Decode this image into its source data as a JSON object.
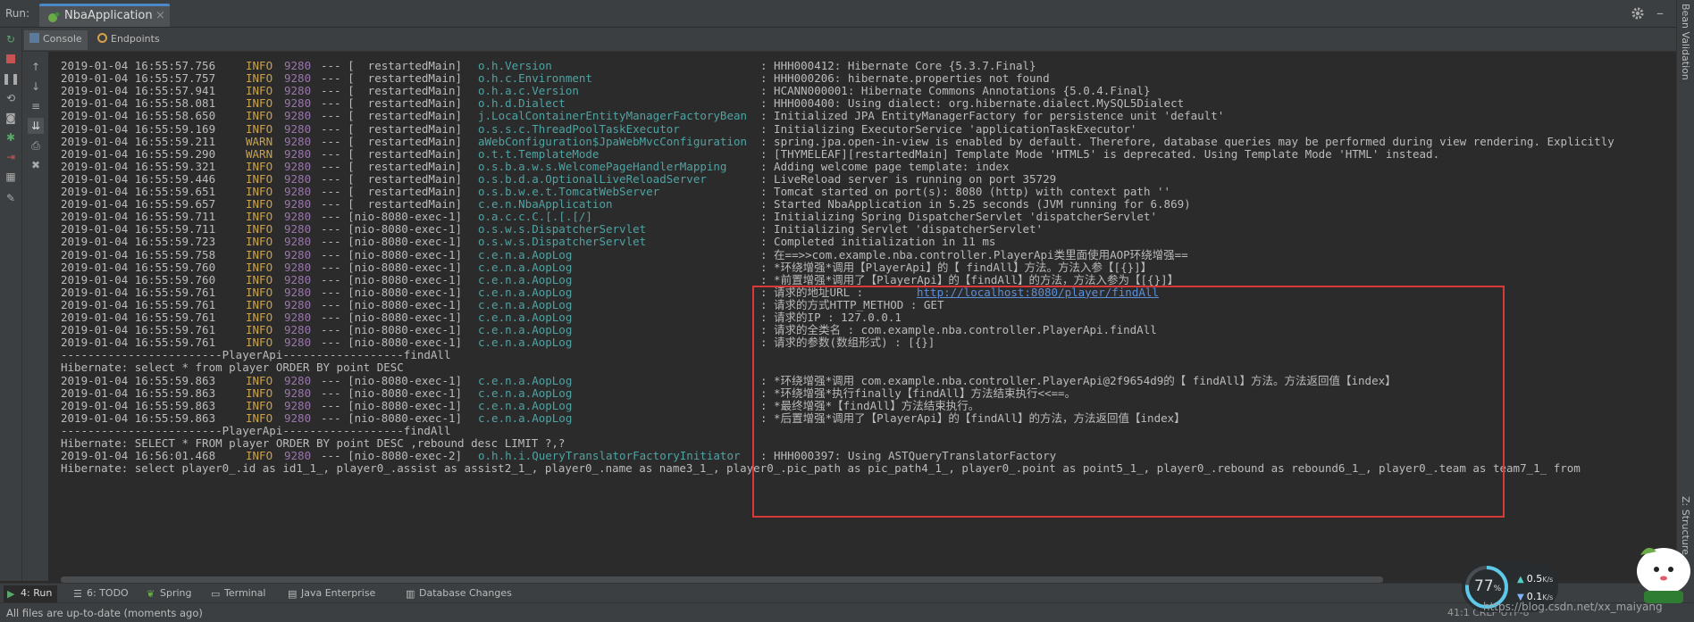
{
  "run_bar": {
    "label": "Run:",
    "tab_title": "NbaApplication",
    "close": "×"
  },
  "right_strip": {
    "top_label": "Bean Validation",
    "bottom_label": "Z: Structure"
  },
  "console_tabs": [
    {
      "label": "Console",
      "icon": "console-icon"
    },
    {
      "label": "Endpoints",
      "icon": "endpoints-icon"
    }
  ],
  "log_lines": [
    {
      "ts": "2019-01-04 16:55:57.756",
      "lv": "INFO",
      "pid": "9280",
      "thr": "--- [  restartedMain]",
      "lg": "o.h.Version",
      "msg": ": HHH000412: Hibernate Core {5.3.7.Final}"
    },
    {
      "ts": "2019-01-04 16:55:57.757",
      "lv": "INFO",
      "pid": "9280",
      "thr": "--- [  restartedMain]",
      "lg": "o.h.c.Environment",
      "msg": ": HHH000206: hibernate.properties not found"
    },
    {
      "ts": "2019-01-04 16:55:57.941",
      "lv": "INFO",
      "pid": "9280",
      "thr": "--- [  restartedMain]",
      "lg": "o.h.a.c.Version",
      "msg": ": HCANN000001: Hibernate Commons Annotations {5.0.4.Final}"
    },
    {
      "ts": "2019-01-04 16:55:58.081",
      "lv": "INFO",
      "pid": "9280",
      "thr": "--- [  restartedMain]",
      "lg": "o.h.d.Dialect",
      "msg": ": HHH000400: Using dialect: org.hibernate.dialect.MySQL5Dialect"
    },
    {
      "ts": "2019-01-04 16:55:58.650",
      "lv": "INFO",
      "pid": "9280",
      "thr": "--- [  restartedMain]",
      "lg": "j.LocalContainerEntityManagerFactoryBean",
      "msg": ": Initialized JPA EntityManagerFactory for persistence unit 'default'"
    },
    {
      "ts": "2019-01-04 16:55:59.169",
      "lv": "INFO",
      "pid": "9280",
      "thr": "--- [  restartedMain]",
      "lg": "o.s.s.c.ThreadPoolTaskExecutor",
      "msg": ": Initializing ExecutorService 'applicationTaskExecutor'"
    },
    {
      "ts": "2019-01-04 16:55:59.211",
      "lv": "WARN",
      "pid": "9280",
      "thr": "--- [  restartedMain]",
      "lg": "aWebConfiguration$JpaWebMvcConfiguration",
      "msg": ": spring.jpa.open-in-view is enabled by default. Therefore, database queries may be performed during view rendering. Explicitly"
    },
    {
      "ts": "2019-01-04 16:55:59.290",
      "lv": "WARN",
      "pid": "9280",
      "thr": "--- [  restartedMain]",
      "lg": "o.t.t.TemplateMode",
      "msg": ": [THYMELEAF][restartedMain] Template Mode 'HTML5' is deprecated. Using Template Mode 'HTML' instead."
    },
    {
      "ts": "2019-01-04 16:55:59.321",
      "lv": "INFO",
      "pid": "9280",
      "thr": "--- [  restartedMain]",
      "lg": "o.s.b.a.w.s.WelcomePageHandlerMapping",
      "msg": ": Adding welcome page template: index"
    },
    {
      "ts": "2019-01-04 16:55:59.446",
      "lv": "INFO",
      "pid": "9280",
      "thr": "--- [  restartedMain]",
      "lg": "o.s.b.d.a.OptionalLiveReloadServer",
      "msg": ": LiveReload server is running on port 35729"
    },
    {
      "ts": "2019-01-04 16:55:59.651",
      "lv": "INFO",
      "pid": "9280",
      "thr": "--- [  restartedMain]",
      "lg": "o.s.b.w.e.t.TomcatWebServer",
      "msg": ": Tomcat started on port(s): 8080 (http) with context path ''"
    },
    {
      "ts": "2019-01-04 16:55:59.657",
      "lv": "INFO",
      "pid": "9280",
      "thr": "--- [  restartedMain]",
      "lg": "c.e.n.NbaApplication",
      "msg": ": Started NbaApplication in 5.25 seconds (JVM running for 6.869)"
    },
    {
      "ts": "2019-01-04 16:55:59.711",
      "lv": "INFO",
      "pid": "9280",
      "thr": "--- [nio-8080-exec-1]",
      "lg": "o.a.c.c.C.[.[.[/]",
      "msg": ": Initializing Spring DispatcherServlet 'dispatcherServlet'"
    },
    {
      "ts": "2019-01-04 16:55:59.711",
      "lv": "INFO",
      "pid": "9280",
      "thr": "--- [nio-8080-exec-1]",
      "lg": "o.s.w.s.DispatcherServlet",
      "msg": ": Initializing Servlet 'dispatcherServlet'"
    },
    {
      "ts": "2019-01-04 16:55:59.723",
      "lv": "INFO",
      "pid": "9280",
      "thr": "--- [nio-8080-exec-1]",
      "lg": "o.s.w.s.DispatcherServlet",
      "msg": ": Completed initialization in 11 ms"
    },
    {
      "ts": "2019-01-04 16:55:59.758",
      "lv": "INFO",
      "pid": "9280",
      "thr": "--- [nio-8080-exec-1]",
      "lg": "c.e.n.a.AopLog",
      "msg": ": 在==>>com.example.nba.controller.PlayerApi类里面使用AOP环绕增强=="
    },
    {
      "ts": "2019-01-04 16:55:59.760",
      "lv": "INFO",
      "pid": "9280",
      "thr": "--- [nio-8080-exec-1]",
      "lg": "c.e.n.a.AopLog",
      "msg": ": *环绕增强*调用【PlayerApi】的【 findAll】方法。方法入参【[{}]】"
    },
    {
      "ts": "2019-01-04 16:55:59.760",
      "lv": "INFO",
      "pid": "9280",
      "thr": "--- [nio-8080-exec-1]",
      "lg": "c.e.n.a.AopLog",
      "msg": ": *前置增强*调用了【PlayerApi】的【findAll】的方法，方法入参为【[{}]】"
    },
    {
      "ts": "2019-01-04 16:55:59.761",
      "lv": "INFO",
      "pid": "9280",
      "thr": "--- [nio-8080-exec-1]",
      "lg": "c.e.n.a.AopLog",
      "msg": ": 请求的地址URL : ",
      "link": "http://localhost:8080/player/findAll"
    },
    {
      "ts": "2019-01-04 16:55:59.761",
      "lv": "INFO",
      "pid": "9280",
      "thr": "--- [nio-8080-exec-1]",
      "lg": "c.e.n.a.AopLog",
      "msg": ": 请求的方式HTTP_METHOD : GET"
    },
    {
      "ts": "2019-01-04 16:55:59.761",
      "lv": "INFO",
      "pid": "9280",
      "thr": "--- [nio-8080-exec-1]",
      "lg": "c.e.n.a.AopLog",
      "msg": ": 请求的IP : 127.0.0.1"
    },
    {
      "ts": "2019-01-04 16:55:59.761",
      "lv": "INFO",
      "pid": "9280",
      "thr": "--- [nio-8080-exec-1]",
      "lg": "c.e.n.a.AopLog",
      "msg": ": 请求的全类名 : com.example.nba.controller.PlayerApi.findAll"
    },
    {
      "ts": "2019-01-04 16:55:59.761",
      "lv": "INFO",
      "pid": "9280",
      "thr": "--- [nio-8080-exec-1]",
      "lg": "c.e.n.a.AopLog",
      "msg": ": 请求的参数(数组形式) : [{}]"
    },
    {
      "plain": "------------------------PlayerApi------------------findAll"
    },
    {
      "plain": "Hibernate: select * from player ORDER BY point DESC"
    },
    {
      "ts": "2019-01-04 16:55:59.863",
      "lv": "INFO",
      "pid": "9280",
      "thr": "--- [nio-8080-exec-1]",
      "lg": "c.e.n.a.AopLog",
      "msg": ": *环绕增强*调用 com.example.nba.controller.PlayerApi@2f9654d9的【 findAll】方法。方法返回值【index】"
    },
    {
      "ts": "2019-01-04 16:55:59.863",
      "lv": "INFO",
      "pid": "9280",
      "thr": "--- [nio-8080-exec-1]",
      "lg": "c.e.n.a.AopLog",
      "msg": ": *环绕增强*执行finally【findAll】方法结束执行<<==。"
    },
    {
      "ts": "2019-01-04 16:55:59.863",
      "lv": "INFO",
      "pid": "9280",
      "thr": "--- [nio-8080-exec-1]",
      "lg": "c.e.n.a.AopLog",
      "msg": ": *最终增强*【findAll】方法结束执行。"
    },
    {
      "ts": "2019-01-04 16:55:59.863",
      "lv": "INFO",
      "pid": "9280",
      "thr": "--- [nio-8080-exec-1]",
      "lg": "c.e.n.a.AopLog",
      "msg": ": *后置增强*调用了【PlayerApi】的【findAll】的方法，方法返回值【index】"
    },
    {
      "plain": "------------------------PlayerApi------------------findAll"
    },
    {
      "plain": "Hibernate: SELECT * FROM player ORDER BY point DESC ,rebound desc LIMIT ?,?"
    },
    {
      "ts": "2019-01-04 16:56:01.468",
      "lv": "INFO",
      "pid": "9280",
      "thr": "--- [nio-8080-exec-2]",
      "lg": "o.h.h.i.QueryTranslatorFactoryInitiator",
      "msg": ": HHH000397: Using ASTQueryTranslatorFactory"
    },
    {
      "plain": "Hibernate: select player0_.id as id1_1_, player0_.assist as assist2_1_, player0_.name as name3_1_, player0_.pic_path as pic_path4_1_, player0_.point as point5_1_, player0_.rebound as rebound6_1_, player0_.team as team7_1_ from"
    }
  ],
  "bottom_tabs": [
    {
      "label": "4: Run",
      "icon": "run-icon",
      "active": true
    },
    {
      "label": "6: TODO",
      "icon": "todo-icon"
    },
    {
      "label": "Spring",
      "icon": "spring-icon"
    },
    {
      "label": "Terminal",
      "icon": "terminal-icon"
    },
    {
      "label": "Java Enterprise",
      "icon": "java-enterprise-icon"
    },
    {
      "label": "Database Changes",
      "icon": "database-icon"
    }
  ],
  "status": {
    "text": "All files are up-to-date (moments ago)",
    "position": "41:1  CRLF  UTF-8"
  },
  "speed_widget": {
    "percent": "77",
    "percent_unit": "%",
    "up": "0.5",
    "down": "0.1",
    "unit": "K/s"
  },
  "watermark": "https://blog.csdn.net/xx_maiyang",
  "colors": {
    "background": "#2b2b2b",
    "panel": "#3c3f41",
    "info": "#c9a24d",
    "logger": "#4fa3a3",
    "pid": "#9876aa",
    "link": "#5b8fd8",
    "highlight_box": "#d83a3a"
  }
}
